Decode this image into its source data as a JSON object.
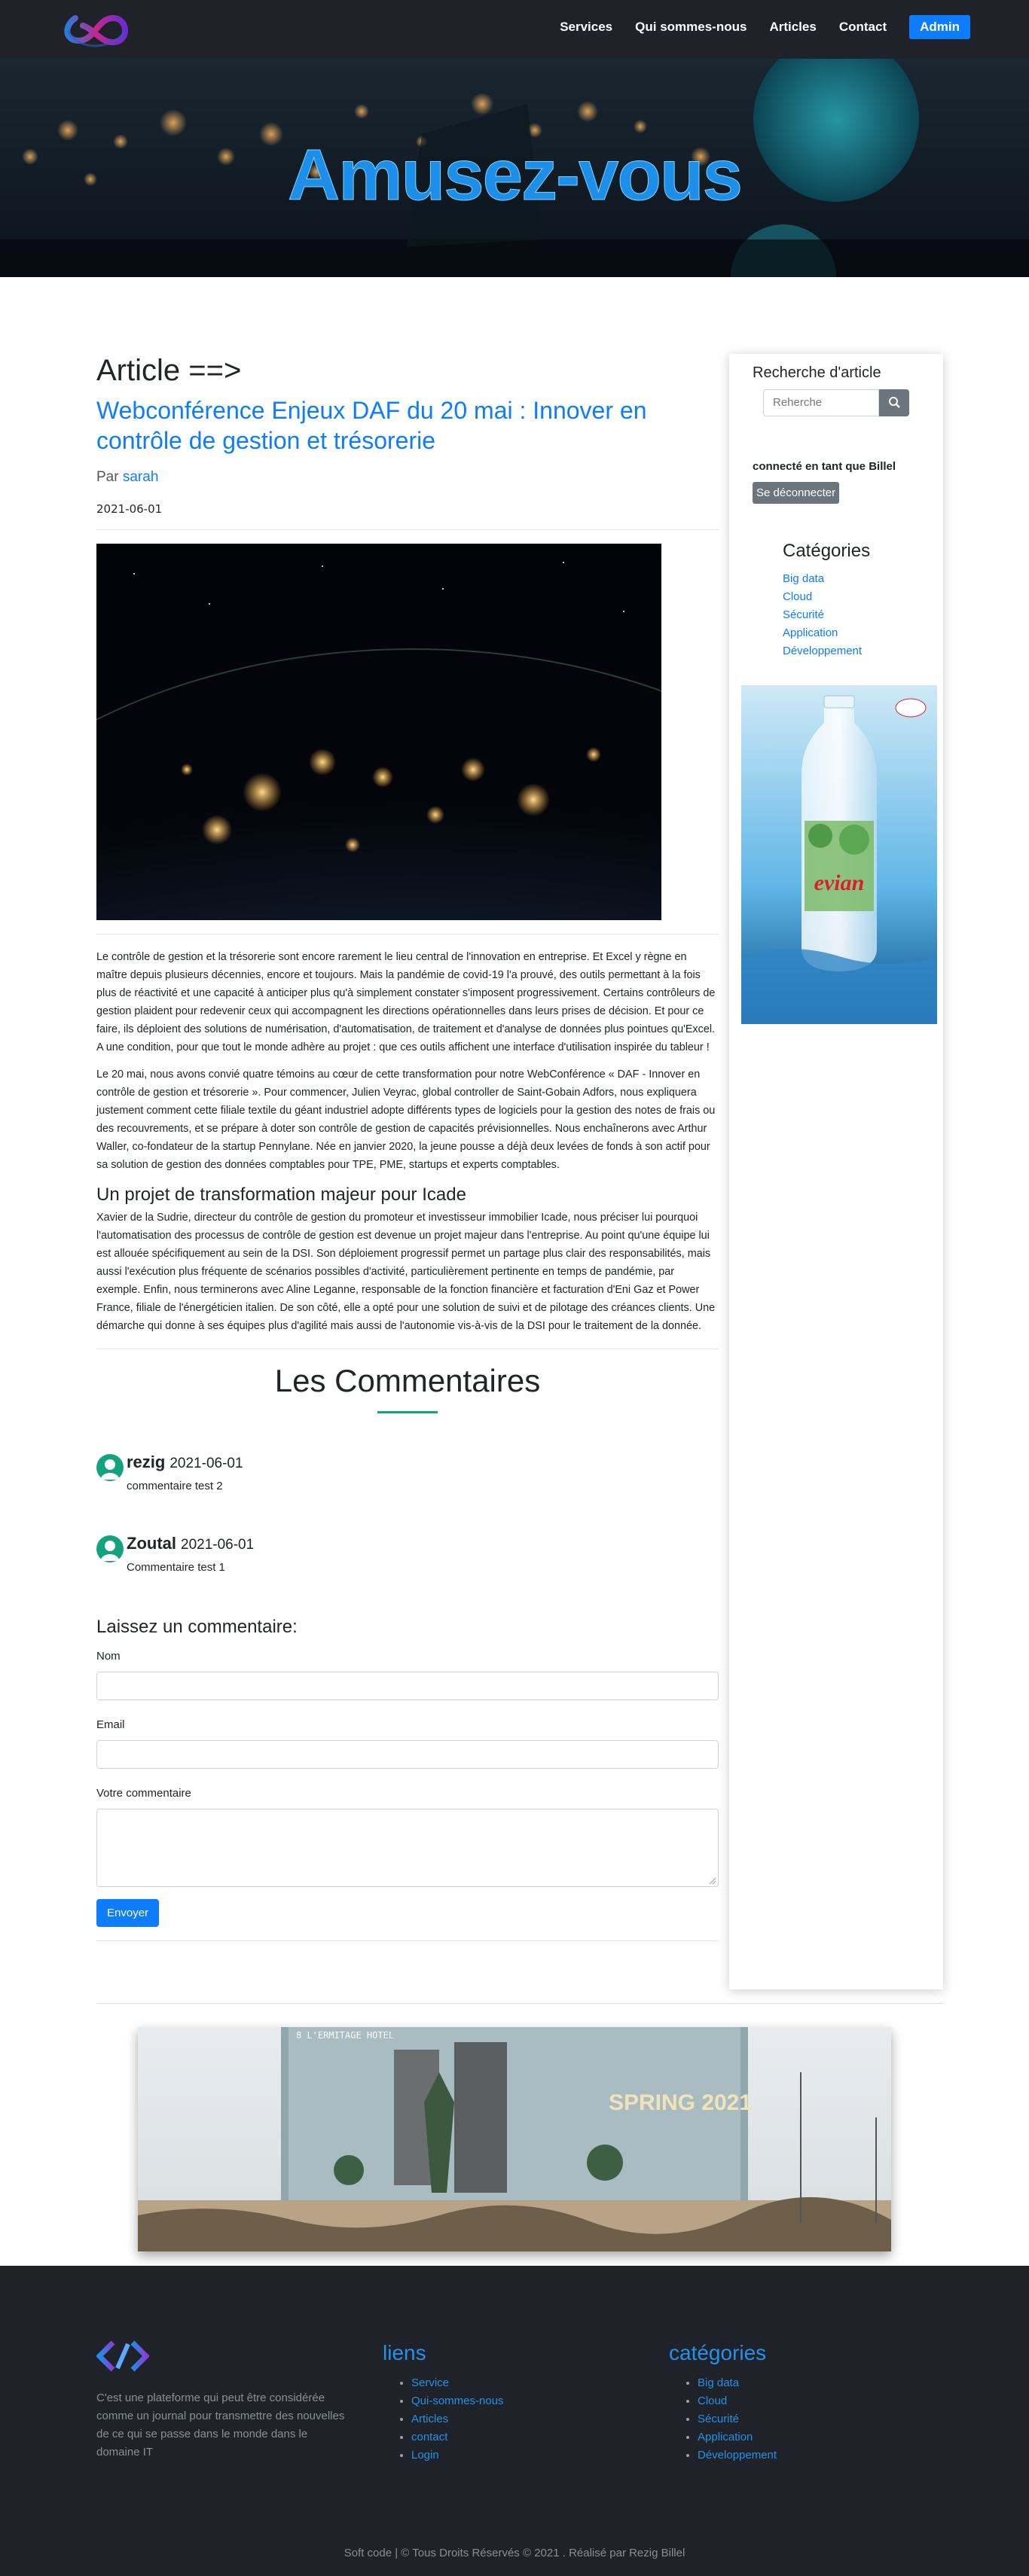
{
  "nav": {
    "items": [
      "Services",
      "Qui sommes-nous",
      "Articles",
      "Contact"
    ],
    "admin": "Admin"
  },
  "hero": {
    "title": "Amusez-vous"
  },
  "article": {
    "heading": "Article ==>",
    "title": "Webconférence Enjeux DAF du 20 mai : Innover en contrôle de gestion et trésorerie",
    "author_prefix": "Par",
    "author": "sarah",
    "date": "2021-06-01",
    "paragraphs": [
      "Le contrôle de gestion et la trésorerie sont encore rarement le lieu central de l'innovation en entreprise. Et Excel y règne en maître depuis plusieurs décennies, encore et toujours. Mais la pandémie de covid-19 l'a prouvé, des outils permettant à la fois plus de réactivité et une capacité à anticiper plus qu'à simplement constater s'imposent progressivement. Certains contrôleurs de gestion plaident pour redevenir ceux qui accompagnent les directions opérationnelles dans leurs prises de décision. Et pour ce faire, ils déploient des solutions de numérisation, d'automatisation, de traitement et d'analyse de données plus pointues qu'Excel. A une condition, pour que tout le monde adhère au projet : que ces outils affichent une interface d'utilisation inspirée du tableur !",
      "Le 20 mai, nous avons convié quatre témoins au cœur de cette transformation pour notre WebConférence « DAF - Innover en contrôle de gestion et trésorerie ». Pour commencer, Julien Veyrac, global controller de Saint-Gobain Adfors, nous expliquera justement comment cette filiale textile du géant industriel adopte différents types de logiciels pour la gestion des notes de frais ou des recouvrements, et se prépare à doter son contrôle de gestion de capacités prévisionnelles. Nous enchaînerons avec Arthur Waller, co-fondateur de la startup Pennylane. Née en janvier 2020, la jeune pousse a déjà deux levées de fonds à son actif pour sa solution de gestion des données comptables pour TPE, PME, startups et experts comptables."
    ],
    "subheading": "Un projet de transformation majeur pour Icade",
    "paragraph3": "Xavier de la Sudrie, directeur du contrôle de gestion du promoteur et investisseur immobilier Icade, nous préciser lui pourquoi l'automatisation des processus de contrôle de gestion est devenue un projet majeur dans l'entreprise. Au point qu'une équipe lui est allouée spécifiquement au sein de la DSI. Son déploiement progressif permet un partage plus clair des responsabilités, mais aussi l'exécution plus fréquente de scénarios possibles d'activité, particulièrement pertinente en temps de pandémie, par exemple. Enfin, nous terminerons avec Aline Leganne, responsable de la fonction financière et facturation d'Eni Gaz et Power France, filiale de l'énergéticien italien. De son côté, elle a opté pour une solution de suivi et de pilotage des créances clients. Une démarche qui donne à ses équipes plus d'agilité mais aussi de l'autonomie vis-à-vis de la DSI pour le traitement de la donnée."
  },
  "comments": {
    "title": "Les Commentaires",
    "items": [
      {
        "name": "rezig",
        "date": "2021-06-01",
        "text": "commentaire test 2"
      },
      {
        "name": "Zoutal",
        "date": "2021-06-01",
        "text": "Commentaire test 1"
      }
    ]
  },
  "form": {
    "title": "Laissez un commentaire:",
    "name_label": "Nom",
    "email_label": "Email",
    "comment_label": "Votre commentaire",
    "submit": "Envoyer"
  },
  "sidebar": {
    "search_title": "Recherche d'article",
    "search_placeholder": "Reherche",
    "connected": "connecté en tant que Billel",
    "logout": "Se déconnecter",
    "categories_title": "Catégories",
    "categories": [
      "Big data",
      "Cloud",
      "Sécurité",
      "Application",
      "Développement"
    ],
    "ad_brand": "evian"
  },
  "banner": {
    "sign_top": "8 L'ERMITAGE HOTEL",
    "sign_text": "SPRING 2021"
  },
  "footer": {
    "description": "C'est une plateforme qui peut être considérée comme un journal pour transmettre des nouvelles de ce qui se passe dans le monde dans le domaine IT",
    "links_title": "liens",
    "links": [
      "Service",
      "Qui-sommes-nous",
      "Articles",
      "contact",
      "Login"
    ],
    "categories_title": "catégories",
    "categories": [
      "Big data",
      "Cloud",
      "Sécurité",
      "Application",
      "Développement"
    ],
    "copyright": "Soft code | © Tous Droits Réservés © 2021 . Réalisé par Rezig Billel"
  },
  "colors": {
    "accent": "#0d7dfd",
    "dark": "#1f2228",
    "green": "#14a37f"
  }
}
